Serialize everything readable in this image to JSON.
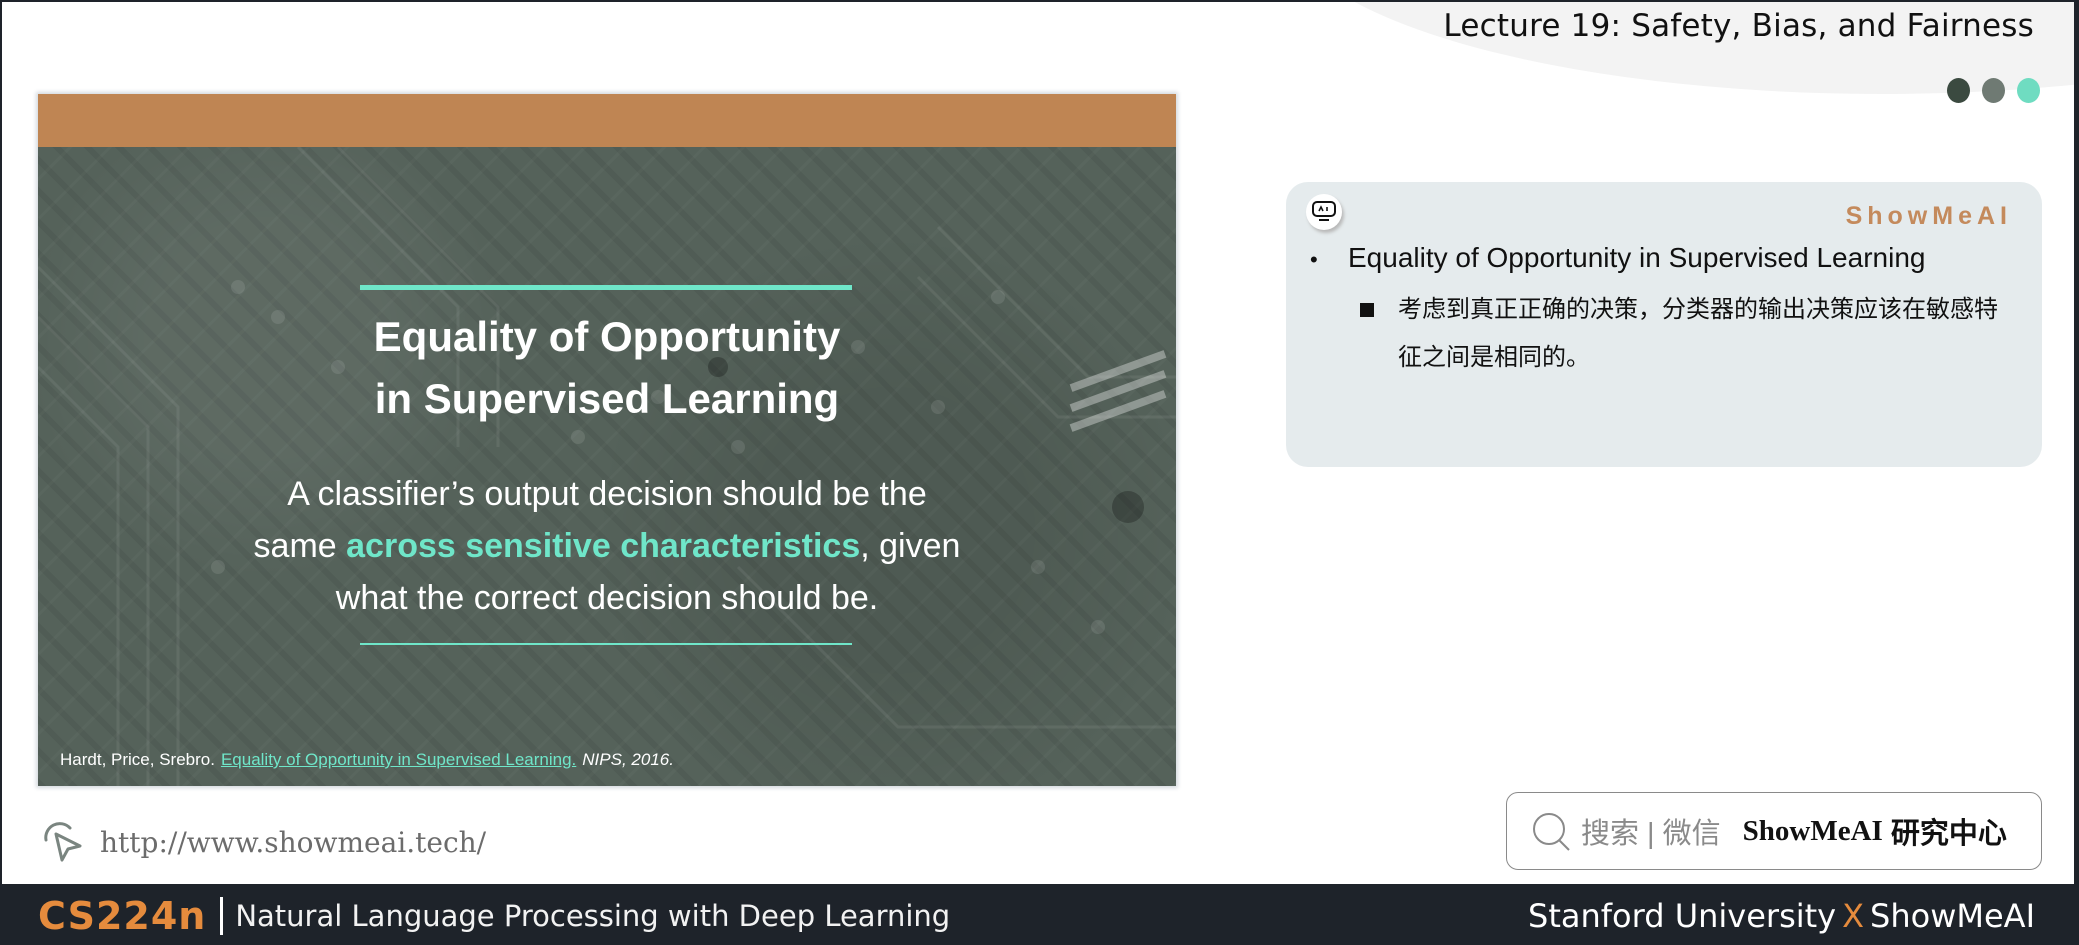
{
  "header": {
    "lecture_title": "Lecture 19: Safety, Bias, and Fairness",
    "dots": [
      {
        "color": "#3b4a40"
      },
      {
        "color": "#6f7a73"
      },
      {
        "color": "#6fdcc1"
      }
    ]
  },
  "slide": {
    "band_color": "#bf8553",
    "heading_line1": "Equality of Opportunity",
    "heading_line2": "in Supervised Learning",
    "body_line1": "A classifier’s output decision should be the",
    "body_line2_before": "same ",
    "body_line2_highlight": "across sensitive characteristics",
    "body_line2_after": ", given",
    "body_line3": "what the correct decision should be.",
    "citation_authors": "Hardt, Price, Srebro.",
    "citation_link": "Equality of Opportunity in Supervised Learning.",
    "citation_venue": "NIPS, 2016.",
    "accent_color": "#6fe6c9"
  },
  "url": {
    "text": "http://www.showmeai.tech/"
  },
  "note": {
    "brand": "ShowMeAI",
    "item_title": "Equality of Opportunity in Supervised Learning",
    "item_bullet": "•",
    "sub_text": "考虑到真正正确的决策，分类器的输出决策应该在敏感特征之间是相同的。"
  },
  "search": {
    "label": "搜索 | 微信",
    "brand": "ShowMeAI",
    "brand_cn": "研究中心"
  },
  "footer": {
    "course_code": "CS224n",
    "course_name": "Natural Language Processing with Deep Learning",
    "partner_left": "Stanford University",
    "partner_x": "X",
    "partner_right": "ShowMeAI"
  }
}
